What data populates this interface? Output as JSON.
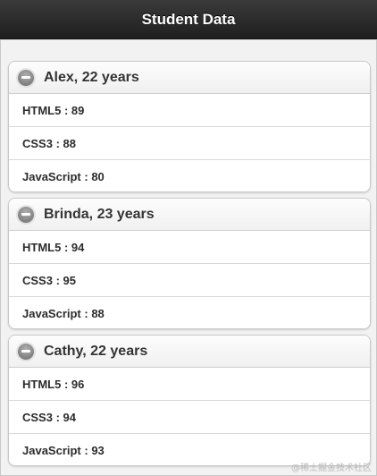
{
  "header": {
    "title": "Student Data"
  },
  "students": [
    {
      "title": "Alex, 22 years",
      "subjects": [
        "HTML5 : 89",
        "CSS3 : 88",
        "JavaScript : 80"
      ]
    },
    {
      "title": "Brinda, 23 years",
      "subjects": [
        "HTML5 : 94",
        "CSS3 : 95",
        "JavaScript : 88"
      ]
    },
    {
      "title": "Cathy, 22 years",
      "subjects": [
        "HTML5 : 96",
        "CSS3 : 94",
        "JavaScript : 93"
      ]
    }
  ],
  "collapse_icon": "minus-circle-icon",
  "watermark": "@稀土掘金技术社区"
}
